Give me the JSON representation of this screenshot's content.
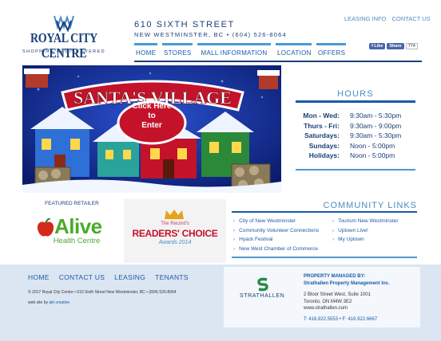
{
  "header": {
    "logo_name": "ROYAL CITY CENTRE",
    "logo_tagline": "SHOPPING REDISCOVERED",
    "address_line1": "610 SIXTH STREET",
    "address_line2": "NEW WESTMINSTER, BC • (604) 526-8064",
    "top_links": [
      "LEASING INFO",
      "CONTACT US"
    ],
    "facebook": {
      "like_label": "Like",
      "share_label": "Share",
      "count": "774"
    }
  },
  "nav": {
    "items": [
      "HOME",
      "STORES",
      "MALL INFORMATION",
      "LOCATION",
      "OFFERS"
    ]
  },
  "hero": {
    "banner_text": "SANTA'S VILLAGE",
    "cta_line1": "Click Here",
    "cta_line2": "to",
    "cta_line3": "Enter"
  },
  "hours": {
    "title": "HOURS",
    "rows": [
      {
        "day": "Mon - Wed:",
        "time": "9:30am - 5:30pm"
      },
      {
        "day": "Thurs - Fri:",
        "time": "9:30am - 9:00pm"
      },
      {
        "day": "Saturdays:",
        "time": "9:30am - 5:30pm"
      },
      {
        "day": "Sundays:",
        "time": "Noon - 5:00pm"
      },
      {
        "day": "Holidays:",
        "time": "Noon - 5:00pm"
      }
    ]
  },
  "featured": {
    "label": "FEATURED RETAILER",
    "alive_name": "Alive",
    "alive_sub": "Health Centre"
  },
  "award": {
    "top": "The Record's",
    "main": "READERS' CHOICE",
    "sub": "Awards 2014"
  },
  "community": {
    "title": "COMMUNITY LINKS",
    "col1": [
      "City of New Westminster",
      "Community Volunteer Connections",
      "Hyack Festival",
      "New West Chamber of Commerce"
    ],
    "col2": [
      "Tourism New Westminster",
      "Uptown Live!",
      "My Uptown"
    ]
  },
  "footer": {
    "nav": [
      "HOME",
      "CONTACT US",
      "LEASING",
      "TENANTS"
    ],
    "copyright": "© 2017 Royal City Centre • 610 Sixth Street New Westminster, BC • (604) 526-8064",
    "web_label": "web site by",
    "web_credit": "akt creative"
  },
  "management": {
    "logo_name": "STRATHALLEN",
    "label": "PROPERTY MANAGED BY:",
    "company": "Strathallen Property Management Inc.",
    "addr1": "2 Bloor Street West, Suite 1001",
    "addr2": "Toronto, ON M4W 3E2",
    "web": "www.strathallen.com",
    "phone": "T: 416.922.5553 • F: 416.922.6667"
  },
  "colors": {
    "navy": "#1a3f78",
    "accent_blue": "#4a9ad6",
    "link_blue": "#1a5aa8",
    "footer_bg": "#dbe6f2",
    "santa_red": "#c4122a"
  }
}
